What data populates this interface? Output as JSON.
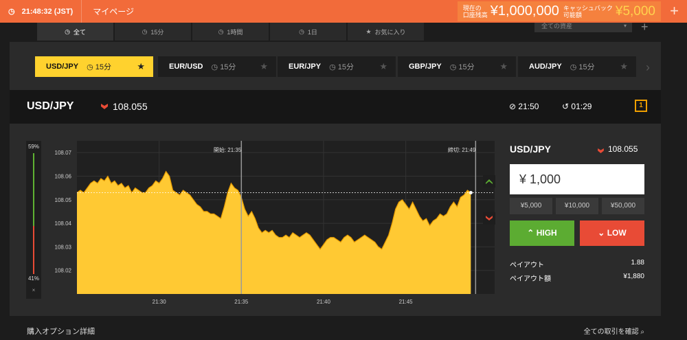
{
  "topbar": {
    "time": "21:48:32 (JST)",
    "mypage": "マイページ",
    "balance_label_1": "現在の",
    "balance_label_2": "口座残高",
    "balance": "¥1,000,000",
    "cashback_label_1": "キャッシュバック",
    "cashback_label_2": "可能額",
    "cashback": "¥5,000",
    "plus": "+"
  },
  "filters": {
    "tabs": [
      {
        "label": "全て",
        "icon": "clock-icon"
      },
      {
        "label": "15分",
        "icon": "clock-icon"
      },
      {
        "label": "1時間",
        "icon": "clock-icon"
      },
      {
        "label": "1日",
        "icon": "clock-icon"
      },
      {
        "label": "お気に入り",
        "icon": "star-icon"
      }
    ],
    "asset_select": "全ての資産",
    "plus": "+"
  },
  "assets": [
    {
      "pair": "USD/JPY",
      "period": "15分"
    },
    {
      "pair": "EUR/USD",
      "period": "15分"
    },
    {
      "pair": "EUR/JPY",
      "period": "15分"
    },
    {
      "pair": "GBP/JPY",
      "period": "15分"
    },
    {
      "pair": "AUD/JPY",
      "period": "15分"
    }
  ],
  "header": {
    "pair": "USD/JPY",
    "rate": "108.055",
    "close_time": "21:50",
    "remaining": "01:29",
    "icon_label": "1"
  },
  "gauge": {
    "high_pct": "59%",
    "low_pct": "41%",
    "close": "×"
  },
  "chart_data": {
    "type": "area",
    "x_ticks": [
      "21:30",
      "21:35",
      "21:40",
      "21:45"
    ],
    "y_ticks": [
      "108.07",
      "108.06",
      "108.05",
      "108.04",
      "108.03",
      "108.02"
    ],
    "ylim": [
      108.01,
      108.075
    ],
    "start_label": "開始: 21:35",
    "end_label": "締切: 21:49",
    "current": 108.053,
    "color": "#ffc933",
    "x": [
      0,
      5,
      10,
      15,
      20,
      25,
      30,
      35,
      40,
      45,
      50,
      55,
      60,
      65,
      70,
      75,
      80,
      85,
      90,
      95,
      100,
      105,
      110,
      115,
      120,
      125,
      130,
      135,
      140,
      145,
      150,
      155,
      160,
      165,
      170,
      175,
      180,
      185,
      190,
      195,
      200,
      205,
      210,
      215,
      220,
      225,
      230,
      235,
      240,
      245,
      250,
      255,
      260,
      265,
      270,
      275,
      280,
      285,
      290,
      295,
      300,
      305,
      310,
      315,
      320,
      325,
      330,
      335,
      340,
      345,
      350,
      355,
      360,
      365,
      370,
      375,
      380,
      385,
      390,
      395,
      400,
      405,
      410,
      415,
      420,
      425,
      430,
      435,
      440,
      445,
      450,
      455,
      460,
      465,
      470,
      475,
      480,
      485,
      490,
      495,
      500,
      505,
      510,
      515,
      520,
      525,
      530,
      535,
      540,
      545,
      550,
      555,
      560,
      565,
      570,
      575
    ],
    "values": [
      108.053,
      108.054,
      108.053,
      108.055,
      108.057,
      108.058,
      108.057,
      108.059,
      108.058,
      108.06,
      108.057,
      108.058,
      108.056,
      108.057,
      108.055,
      108.056,
      108.053,
      108.055,
      108.054,
      108.053,
      108.053,
      108.055,
      108.056,
      108.058,
      108.057,
      108.059,
      108.062,
      108.06,
      108.054,
      108.053,
      108.052,
      108.054,
      108.053,
      108.052,
      108.05,
      108.048,
      108.047,
      108.045,
      108.045,
      108.044,
      108.044,
      108.043,
      108.042,
      108.047,
      108.053,
      108.057,
      108.055,
      108.054,
      108.051,
      108.046,
      108.043,
      108.045,
      108.042,
      108.038,
      108.036,
      108.037,
      108.036,
      108.037,
      108.035,
      108.034,
      108.034,
      108.035,
      108.034,
      108.036,
      108.035,
      108.034,
      108.035,
      108.036,
      108.035,
      108.033,
      108.031,
      108.029,
      108.031,
      108.033,
      108.034,
      108.034,
      108.033,
      108.032,
      108.034,
      108.035,
      108.034,
      108.032,
      108.033,
      108.034,
      108.035,
      108.034,
      108.033,
      108.032,
      108.03,
      108.029,
      108.032,
      108.035,
      108.04,
      108.046,
      108.049,
      108.05,
      108.048,
      108.046,
      108.049,
      108.046,
      108.043,
      108.041,
      108.042,
      108.039,
      108.041,
      108.042,
      108.044,
      108.043,
      108.044,
      108.047,
      108.049,
      108.047,
      108.051,
      108.052,
      108.054,
      108.053
    ]
  },
  "trade": {
    "pair": "USD/JPY",
    "rate": "108.055",
    "amount": "¥ 1,000",
    "quick": [
      "¥5,000",
      "¥10,000",
      "¥50,000"
    ],
    "high": "HIGH",
    "low": "LOW",
    "payout_label": "ペイアウト",
    "payout": "1.88",
    "payout_amount_label": "ペイアウト額",
    "payout_amount": "¥1,880"
  },
  "bottom": {
    "left": "購入オプション詳細",
    "right": "全ての取引を確認"
  }
}
